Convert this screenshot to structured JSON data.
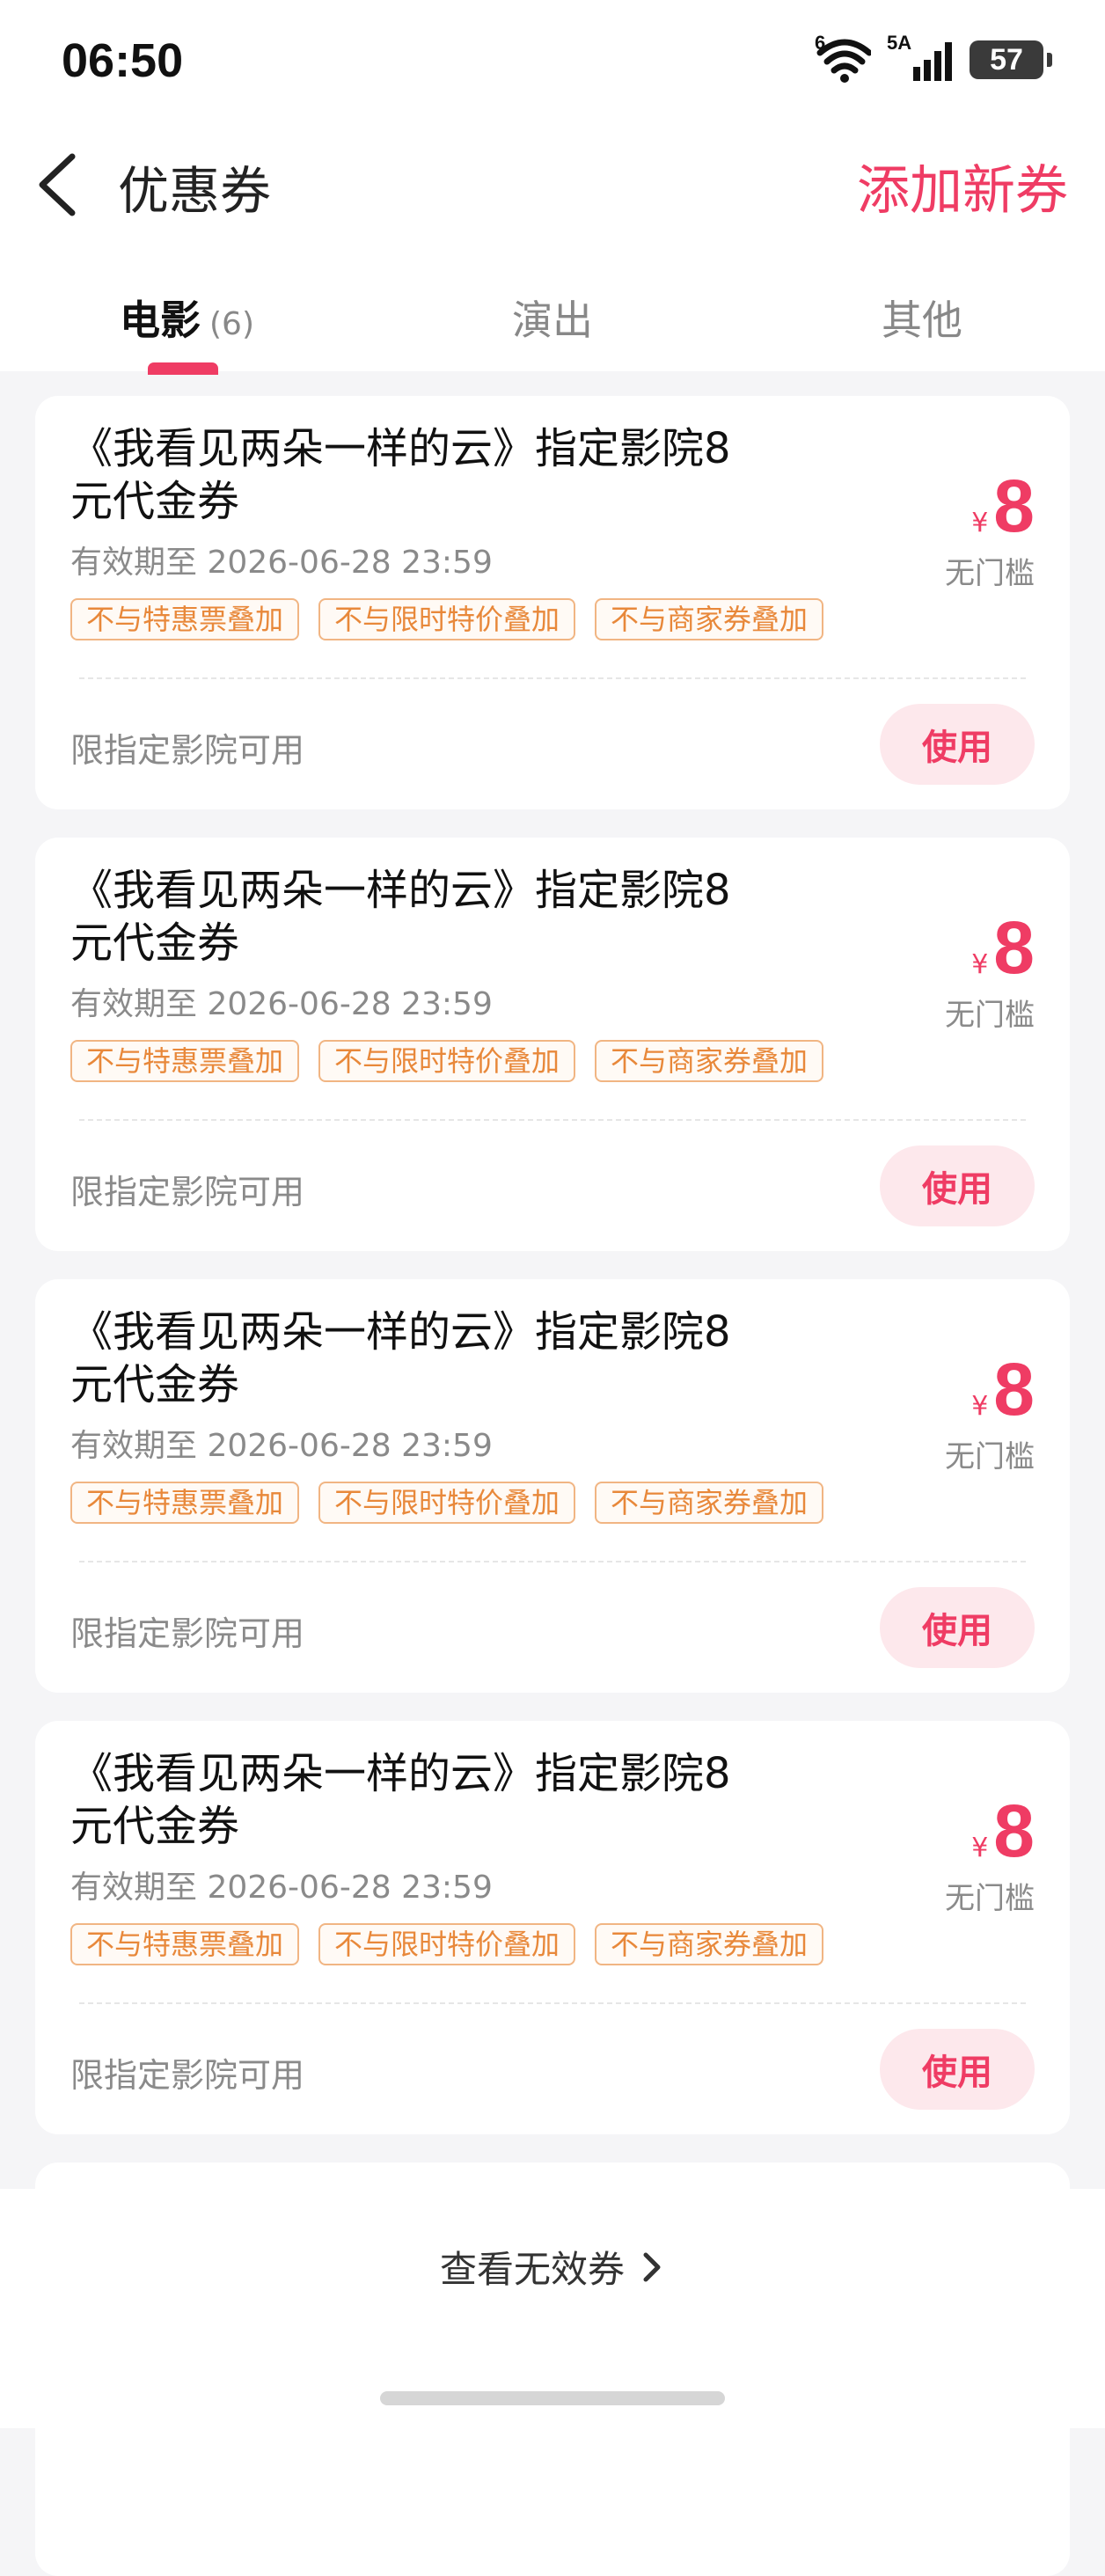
{
  "status_bar": {
    "time": "06:50",
    "wifi_label": "6",
    "cellular_label": "5A",
    "battery": "57"
  },
  "nav": {
    "title": "优惠券",
    "action": "添加新券"
  },
  "tabs": [
    {
      "label": "电影",
      "count": "(6)",
      "active": true
    },
    {
      "label": "演出",
      "count": "",
      "active": false
    },
    {
      "label": "其他",
      "count": "",
      "active": false
    }
  ],
  "coupons": [
    {
      "title": "《我看见两朵一样的云》指定影院8元代金券",
      "validity": "有效期至 2026-06-28 23:59",
      "tags": [
        "不与特惠票叠加",
        "不与限时特价叠加",
        "不与商家券叠加"
      ],
      "currency": "¥",
      "amount": "8",
      "threshold": "无门槛",
      "scope": "限指定影院可用",
      "action": "使用"
    },
    {
      "title": "《我看见两朵一样的云》指定影院8元代金券",
      "validity": "有效期至 2026-06-28 23:59",
      "tags": [
        "不与特惠票叠加",
        "不与限时特价叠加",
        "不与商家券叠加"
      ],
      "currency": "¥",
      "amount": "8",
      "threshold": "无门槛",
      "scope": "限指定影院可用",
      "action": "使用"
    },
    {
      "title": "《我看见两朵一样的云》指定影院8元代金券",
      "validity": "有效期至 2026-06-28 23:59",
      "tags": [
        "不与特惠票叠加",
        "不与限时特价叠加",
        "不与商家券叠加"
      ],
      "currency": "¥",
      "amount": "8",
      "threshold": "无门槛",
      "scope": "限指定影院可用",
      "action": "使用"
    },
    {
      "title": "《我看见两朵一样的云》指定影院8元代金券",
      "validity": "有效期至 2026-06-28 23:59",
      "tags": [
        "不与特惠票叠加",
        "不与限时特价叠加",
        "不与商家券叠加"
      ],
      "currency": "¥",
      "amount": "8",
      "threshold": "无门槛",
      "scope": "限指定影院可用",
      "action": "使用"
    }
  ],
  "footer": {
    "view_invalid": "查看无效券"
  },
  "colors": {
    "accent": "#ef3c64",
    "tag_text": "#e8883a",
    "tag_border": "#f1b583"
  }
}
